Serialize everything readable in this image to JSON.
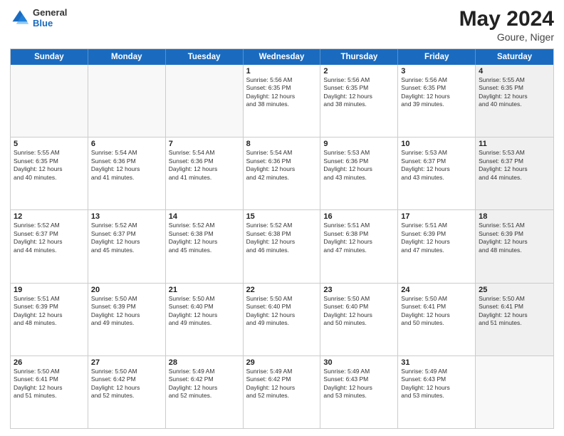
{
  "header": {
    "logo_general": "General",
    "logo_blue": "Blue",
    "month_year": "May 2024",
    "location": "Goure, Niger"
  },
  "calendar": {
    "days_of_week": [
      "Sunday",
      "Monday",
      "Tuesday",
      "Wednesday",
      "Thursday",
      "Friday",
      "Saturday"
    ],
    "rows": [
      [
        {
          "day": "",
          "text": "",
          "empty": true
        },
        {
          "day": "",
          "text": "",
          "empty": true
        },
        {
          "day": "",
          "text": "",
          "empty": true
        },
        {
          "day": "1",
          "text": "Sunrise: 5:56 AM\nSunset: 6:35 PM\nDaylight: 12 hours\nand 38 minutes."
        },
        {
          "day": "2",
          "text": "Sunrise: 5:56 AM\nSunset: 6:35 PM\nDaylight: 12 hours\nand 38 minutes."
        },
        {
          "day": "3",
          "text": "Sunrise: 5:56 AM\nSunset: 6:35 PM\nDaylight: 12 hours\nand 39 minutes."
        },
        {
          "day": "4",
          "text": "Sunrise: 5:55 AM\nSunset: 6:35 PM\nDaylight: 12 hours\nand 40 minutes.",
          "shaded": true
        }
      ],
      [
        {
          "day": "5",
          "text": "Sunrise: 5:55 AM\nSunset: 6:35 PM\nDaylight: 12 hours\nand 40 minutes."
        },
        {
          "day": "6",
          "text": "Sunrise: 5:54 AM\nSunset: 6:36 PM\nDaylight: 12 hours\nand 41 minutes."
        },
        {
          "day": "7",
          "text": "Sunrise: 5:54 AM\nSunset: 6:36 PM\nDaylight: 12 hours\nand 41 minutes."
        },
        {
          "day": "8",
          "text": "Sunrise: 5:54 AM\nSunset: 6:36 PM\nDaylight: 12 hours\nand 42 minutes."
        },
        {
          "day": "9",
          "text": "Sunrise: 5:53 AM\nSunset: 6:36 PM\nDaylight: 12 hours\nand 43 minutes."
        },
        {
          "day": "10",
          "text": "Sunrise: 5:53 AM\nSunset: 6:37 PM\nDaylight: 12 hours\nand 43 minutes."
        },
        {
          "day": "11",
          "text": "Sunrise: 5:53 AM\nSunset: 6:37 PM\nDaylight: 12 hours\nand 44 minutes.",
          "shaded": true
        }
      ],
      [
        {
          "day": "12",
          "text": "Sunrise: 5:52 AM\nSunset: 6:37 PM\nDaylight: 12 hours\nand 44 minutes."
        },
        {
          "day": "13",
          "text": "Sunrise: 5:52 AM\nSunset: 6:37 PM\nDaylight: 12 hours\nand 45 minutes."
        },
        {
          "day": "14",
          "text": "Sunrise: 5:52 AM\nSunset: 6:38 PM\nDaylight: 12 hours\nand 45 minutes."
        },
        {
          "day": "15",
          "text": "Sunrise: 5:52 AM\nSunset: 6:38 PM\nDaylight: 12 hours\nand 46 minutes."
        },
        {
          "day": "16",
          "text": "Sunrise: 5:51 AM\nSunset: 6:38 PM\nDaylight: 12 hours\nand 47 minutes."
        },
        {
          "day": "17",
          "text": "Sunrise: 5:51 AM\nSunset: 6:39 PM\nDaylight: 12 hours\nand 47 minutes."
        },
        {
          "day": "18",
          "text": "Sunrise: 5:51 AM\nSunset: 6:39 PM\nDaylight: 12 hours\nand 48 minutes.",
          "shaded": true
        }
      ],
      [
        {
          "day": "19",
          "text": "Sunrise: 5:51 AM\nSunset: 6:39 PM\nDaylight: 12 hours\nand 48 minutes."
        },
        {
          "day": "20",
          "text": "Sunrise: 5:50 AM\nSunset: 6:39 PM\nDaylight: 12 hours\nand 49 minutes."
        },
        {
          "day": "21",
          "text": "Sunrise: 5:50 AM\nSunset: 6:40 PM\nDaylight: 12 hours\nand 49 minutes."
        },
        {
          "day": "22",
          "text": "Sunrise: 5:50 AM\nSunset: 6:40 PM\nDaylight: 12 hours\nand 49 minutes."
        },
        {
          "day": "23",
          "text": "Sunrise: 5:50 AM\nSunset: 6:40 PM\nDaylight: 12 hours\nand 50 minutes."
        },
        {
          "day": "24",
          "text": "Sunrise: 5:50 AM\nSunset: 6:41 PM\nDaylight: 12 hours\nand 50 minutes."
        },
        {
          "day": "25",
          "text": "Sunrise: 5:50 AM\nSunset: 6:41 PM\nDaylight: 12 hours\nand 51 minutes.",
          "shaded": true
        }
      ],
      [
        {
          "day": "26",
          "text": "Sunrise: 5:50 AM\nSunset: 6:41 PM\nDaylight: 12 hours\nand 51 minutes."
        },
        {
          "day": "27",
          "text": "Sunrise: 5:50 AM\nSunset: 6:42 PM\nDaylight: 12 hours\nand 52 minutes."
        },
        {
          "day": "28",
          "text": "Sunrise: 5:49 AM\nSunset: 6:42 PM\nDaylight: 12 hours\nand 52 minutes."
        },
        {
          "day": "29",
          "text": "Sunrise: 5:49 AM\nSunset: 6:42 PM\nDaylight: 12 hours\nand 52 minutes."
        },
        {
          "day": "30",
          "text": "Sunrise: 5:49 AM\nSunset: 6:43 PM\nDaylight: 12 hours\nand 53 minutes."
        },
        {
          "day": "31",
          "text": "Sunrise: 5:49 AM\nSunset: 6:43 PM\nDaylight: 12 hours\nand 53 minutes."
        },
        {
          "day": "",
          "text": "",
          "empty": true,
          "shaded": true
        }
      ]
    ]
  }
}
